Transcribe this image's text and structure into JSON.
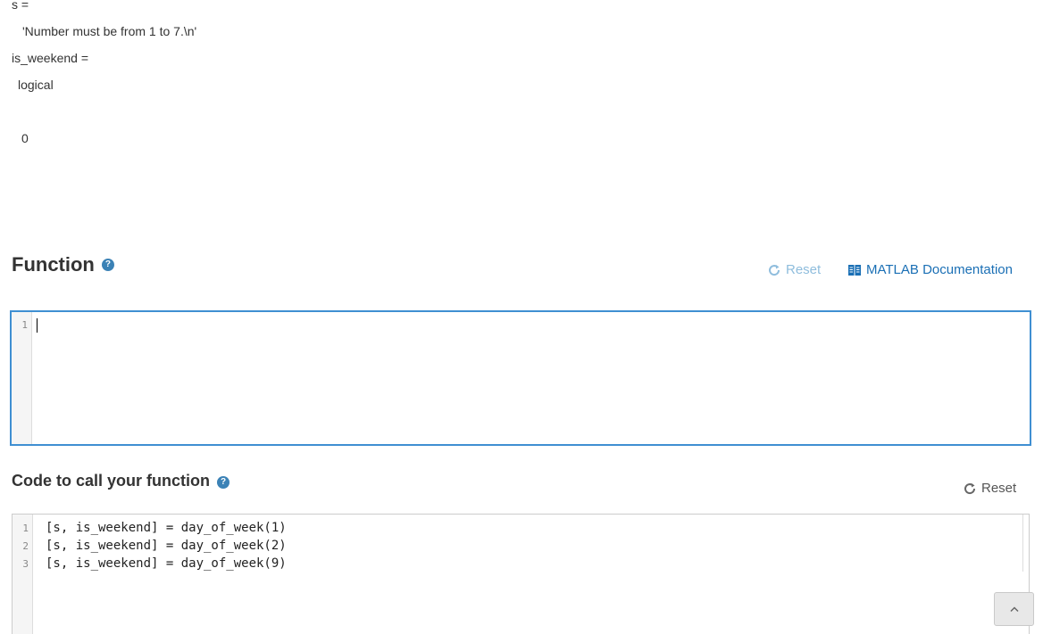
{
  "output": {
    "lines": [
      "s =",
      "'Number must be from 1 to 7.\\n'",
      "is_weekend =",
      "logical",
      "0"
    ]
  },
  "function_section": {
    "title": "Function",
    "help_icon": "question-circle-icon",
    "reset_label": "Reset",
    "doc_label": "MATLAB Documentation",
    "editor": {
      "line_numbers": [
        "1"
      ],
      "lines": [
        ""
      ]
    }
  },
  "call_section": {
    "title": "Code to call your function",
    "help_icon": "question-circle-icon",
    "reset_label": "Reset",
    "editor": {
      "line_numbers": [
        "1",
        "2",
        "3"
      ],
      "lines": [
        "[s, is_weekend] = day_of_week(1)",
        "[s, is_weekend] = day_of_week(2)",
        "[s, is_weekend] = day_of_week(9)"
      ]
    }
  },
  "back_to_top_icon": "chevron-up-icon",
  "colors": {
    "focus_border": "#3f8fd2",
    "link": "#1a6fb5",
    "reset_disabled": "#8fbddd",
    "help_icon": "#3b82b6"
  }
}
